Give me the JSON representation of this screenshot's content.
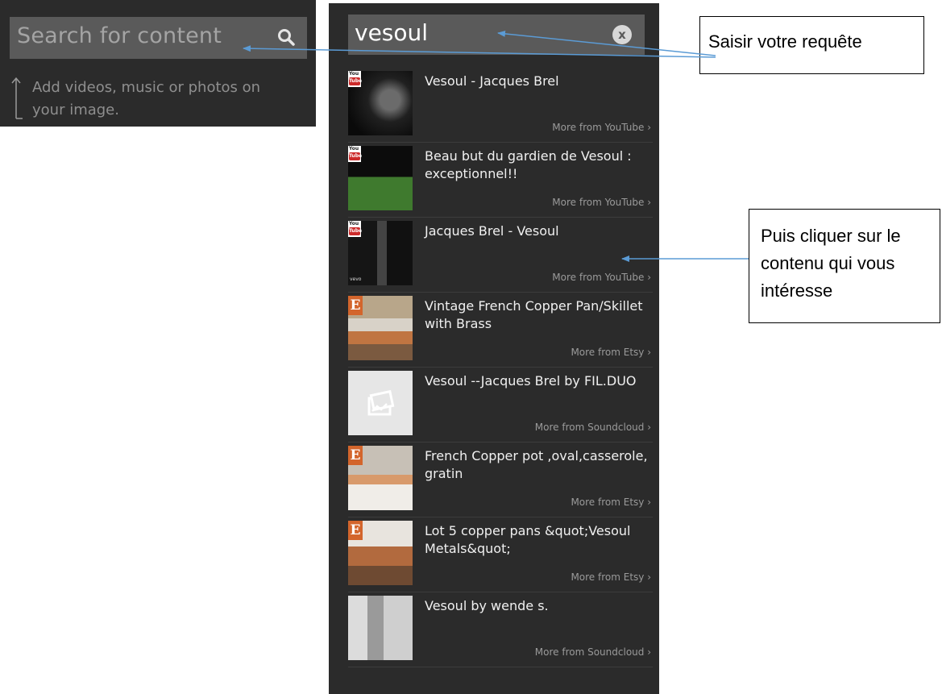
{
  "left_panel": {
    "search_placeholder": "Search for content",
    "hint": "Add videos, music or photos on your image."
  },
  "results_panel": {
    "query": "vesoul",
    "clear_icon": "x",
    "results": [
      {
        "title": "Vesoul - Jacques Brel",
        "source": "More from YouTube ›",
        "provider": "youtube"
      },
      {
        "title": "Beau but du gardien de Vesoul : exceptionnel!!",
        "source": "More from YouTube ›",
        "provider": "youtube"
      },
      {
        "title": "Jacques Brel - Vesoul",
        "source": "More from YouTube ›",
        "provider": "youtube"
      },
      {
        "title": "Vintage French Copper Pan/Skillet with Brass",
        "source": "More from Etsy ›",
        "provider": "etsy"
      },
      {
        "title": "Vesoul --Jacques Brel by FIL.DUO",
        "source": "More from Soundcloud ›",
        "provider": "soundcloud"
      },
      {
        "title": "French Copper pot ,oval,casserole, gratin",
        "source": "More from Etsy ›",
        "provider": "etsy"
      },
      {
        "title": "Lot 5 copper pans &quot;Vesoul Metals&quot;",
        "source": "More from Etsy ›",
        "provider": "etsy"
      },
      {
        "title": "Vesoul by wende s.",
        "source": "More from Soundcloud ›",
        "provider": "soundcloud"
      }
    ]
  },
  "badges": {
    "youtube_you": "You",
    "youtube_tube": "Tube",
    "etsy": "E",
    "thumb_caption_vevo": "vevo"
  },
  "callouts": {
    "enter_query": "Saisir votre requête",
    "click_content": "Puis cliquer sur le contenu qui vous intéresse"
  },
  "colors": {
    "panel_bg": "#2b2b2b",
    "search_bg": "#5a5a5a",
    "etsy_orange": "#d3652c",
    "youtube_red": "#cc2b2b",
    "arrow_blue": "#5b9bd5"
  }
}
